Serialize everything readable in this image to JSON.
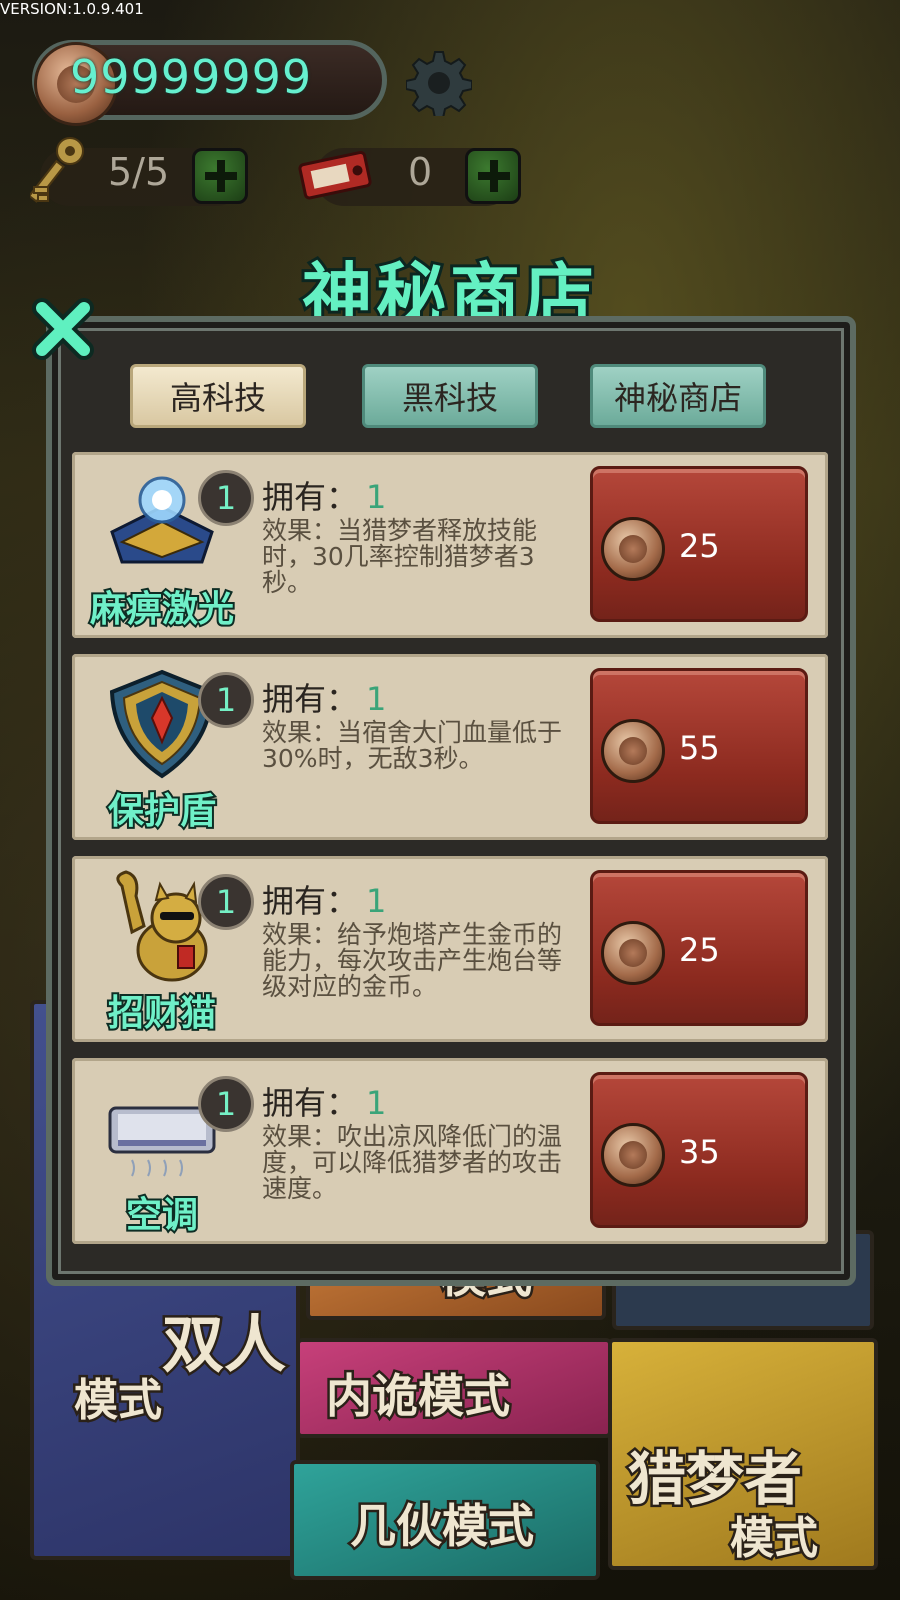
{
  "version": "VERSION:1.0.9.401",
  "hud": {
    "coins": "99999999",
    "keys": "5/5",
    "tickets": "0"
  },
  "title": "神秘商店",
  "tabs": [
    {
      "label": "高科技",
      "active": true
    },
    {
      "label": "黑科技",
      "active": false
    },
    {
      "label": "神秘商店",
      "active": false
    }
  ],
  "owned_label": "拥有：",
  "items": [
    {
      "name": "麻痹激光",
      "level": "1",
      "owned": "1",
      "effect": "效果：当猎梦者释放技能时，30几率控制猎梦者3秒。",
      "price": "25",
      "icon": "laser-tower-icon"
    },
    {
      "name": "保护盾",
      "level": "1",
      "owned": "1",
      "effect": "效果：当宿舍大门血量低于30%时，无敌3秒。",
      "price": "55",
      "icon": "shield-icon"
    },
    {
      "name": "招财猫",
      "level": "1",
      "owned": "1",
      "effect": "效果：给予炮塔产生金币的能力，每次攻击产生炮台等级对应的金币。",
      "price": "25",
      "icon": "lucky-cat-icon"
    },
    {
      "name": "空调",
      "level": "1",
      "owned": "1",
      "effect": "效果：吹出凉风降低门的温度，可以降低猎梦者的攻击速度。",
      "price": "35",
      "icon": "air-conditioner-icon"
    }
  ],
  "modes": {
    "duo_line1": "双人",
    "duo_line2": "模式",
    "mode_top_partial": "模式",
    "inner": "内诡模式",
    "guys": "几伙模式",
    "hunter_line1": "猎梦者",
    "hunter_line2": "模式"
  }
}
